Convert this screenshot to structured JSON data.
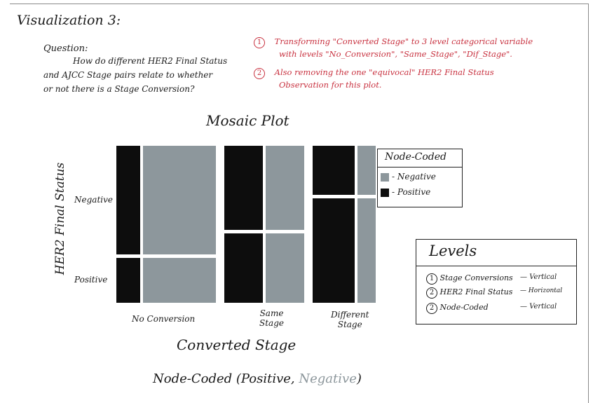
{
  "page_title": "Visualization 3:",
  "question_label": "Question:",
  "question_lines": [
    "How do different HER2 Final Status",
    "and AJCC Stage pairs relate to whether",
    "or not there is a Stage Conversion?"
  ],
  "notes": {
    "note1_number": "1",
    "note1_lines": [
      "Transforming \"Converted Stage\" to 3 level categorical variable",
      "with levels \"No_Conversion\", \"Same_Stage\", \"Dif_Stage\"."
    ],
    "note2_number": "2",
    "note2_lines": [
      "Also removing the one \"equivocal\" HER2 Final Status",
      "Observation for this plot."
    ],
    "color": "#c8313f"
  },
  "plot": {
    "title": "Mosaic Plot",
    "y_axis_label": "HER2 Final Status",
    "row_labels": {
      "negative": "Negative",
      "positive": "Positive"
    },
    "column_labels": [
      "No Conversion",
      "Same\nStage",
      "Different\nStage"
    ],
    "x_axis_label": "Converted Stage",
    "subtitle_prefix": "Node-Coded (Positive, ",
    "subtitle_gray": "Negative",
    "subtitle_suffix": ")"
  },
  "node_legend": {
    "title": "Node-Coded",
    "items": [
      {
        "label": "- Negative",
        "color": "#8d979c"
      },
      {
        "label": "- Positive",
        "color": "#0d0d0d"
      }
    ]
  },
  "levels_legend": {
    "title": "Levels",
    "items": [
      {
        "number": "1",
        "name": "Stage Conversions",
        "orientation": "Vertical"
      },
      {
        "number": "2",
        "name": "HER2 Final Status",
        "orientation": "Horizontal"
      },
      {
        "number": "2",
        "name": "Node-Coded",
        "orientation": "Vertical"
      }
    ]
  },
  "colors": {
    "node_positive": "#0d0d0d",
    "node_negative": "#8d979c"
  },
  "chart_data": {
    "type": "mosaic",
    "x_variable": "Converted Stage",
    "y_variable": "HER2 Final Status",
    "fill_variable": "Node-Coded",
    "columns": [
      {
        "category": "No Conversion",
        "column_share": 0.41,
        "rows": [
          {
            "her2": "Negative",
            "row_share": 0.71,
            "node_positive_share": 0.25,
            "node_negative_share": 0.75
          },
          {
            "her2": "Positive",
            "row_share": 0.29,
            "node_positive_share": 0.25,
            "node_negative_share": 0.75
          }
        ]
      },
      {
        "category": "Same Stage",
        "column_share": 0.33,
        "rows": [
          {
            "her2": "Negative",
            "row_share": 0.55,
            "node_positive_share": 0.5,
            "node_negative_share": 0.5
          },
          {
            "her2": "Positive",
            "row_share": 0.45,
            "node_positive_share": 0.5,
            "node_negative_share": 0.5
          }
        ]
      },
      {
        "category": "Different Stage",
        "column_share": 0.26,
        "rows": [
          {
            "her2": "Negative",
            "row_share": 0.32,
            "node_positive_share": 0.7,
            "node_negative_share": 0.3
          },
          {
            "her2": "Positive",
            "row_share": 0.68,
            "node_positive_share": 0.7,
            "node_negative_share": 0.3
          }
        ]
      }
    ]
  }
}
